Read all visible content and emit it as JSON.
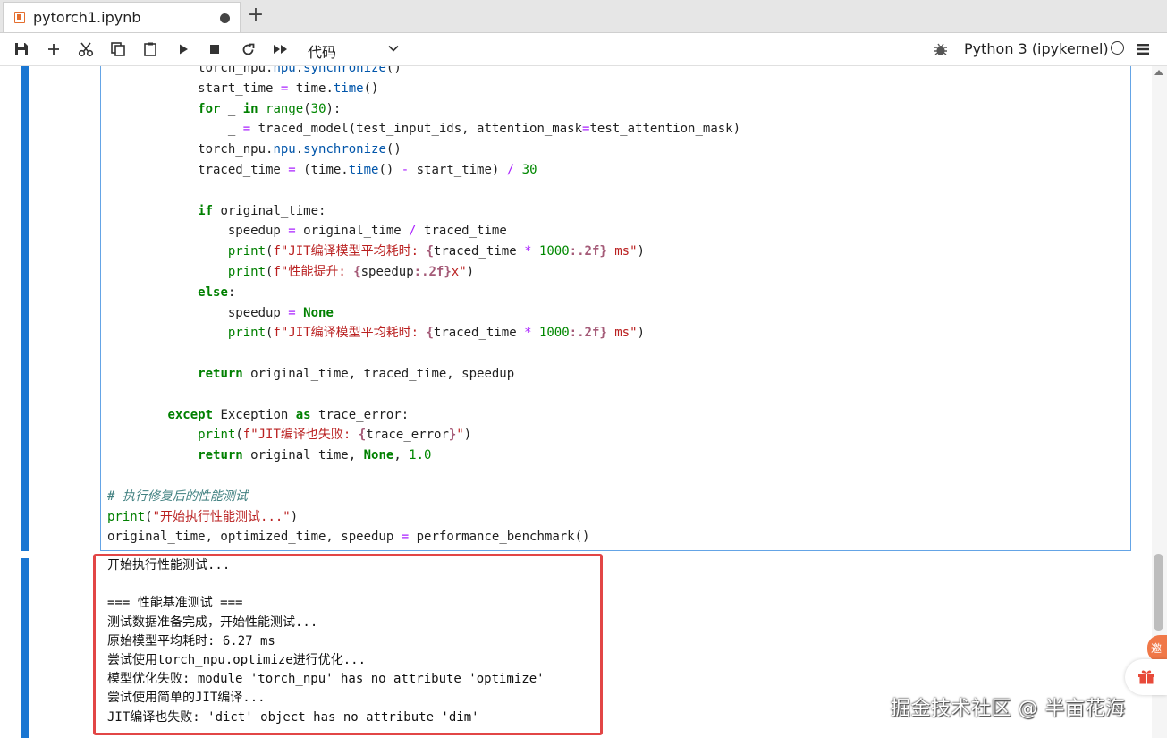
{
  "tab": {
    "title": "pytorch1.ipynb",
    "new_tab_label": "+"
  },
  "toolbar": {
    "cell_type": "代码",
    "kernel_name": "Python 3 (ipykernel)",
    "icons": [
      "save-icon",
      "add-icon",
      "cut-icon",
      "copy-icon",
      "paste-icon",
      "run-icon",
      "stop-icon",
      "restart-icon",
      "fast-forward-icon",
      "chevron-down-icon",
      "bug-icon",
      "kernel-status-icon",
      "menu-icon"
    ]
  },
  "code_lines": [
    "            torch_npu.npu.synchronize()",
    "            start_time = time.time()",
    "            for _ in range(30):",
    "                _ = traced_model(test_input_ids, attention_mask=test_attention_mask)",
    "            torch_npu.npu.synchronize()",
    "            traced_time = (time.time() - start_time) / 30",
    "",
    "            if original_time:",
    "                speedup = original_time / traced_time",
    "                print(f\"JIT编译模型平均耗时: {traced_time * 1000:.2f} ms\")",
    "                print(f\"性能提升: {speedup:.2f}x\")",
    "            else:",
    "                speedup = None",
    "                print(f\"JIT编译模型平均耗时: {traced_time * 1000:.2f} ms\")",
    "",
    "            return original_time, traced_time, speedup",
    "",
    "        except Exception as trace_error:",
    "            print(f\"JIT编译也失败: {trace_error}\")",
    "            return original_time, None, 1.0",
    "",
    "# 执行修复后的性能测试",
    "print(\"开始执行性能测试...\")",
    "original_time, optimized_time, speedup = performance_benchmark()"
  ],
  "output_lines": [
    "开始执行性能测试...",
    "",
    "=== 性能基准测试 ===",
    "测试数据准备完成，开始性能测试...",
    "原始模型平均耗时: 6.27 ms",
    "尝试使用torch_npu.optimize进行优化...",
    "模型优化失败: module 'torch_npu' has no attribute 'optimize'",
    "尝试使用简单的JIT编译...",
    "JIT编译也失败: 'dict' object has no attribute 'dim'"
  ],
  "side_widgets": {
    "invite_label": "邀请"
  },
  "watermark": "掘金技术社区 @ 半亩花海",
  "colors": {
    "cell_bar": "#1976d2",
    "highlight": "#e24646",
    "keyword": "#008000",
    "string": "#ba2121"
  }
}
